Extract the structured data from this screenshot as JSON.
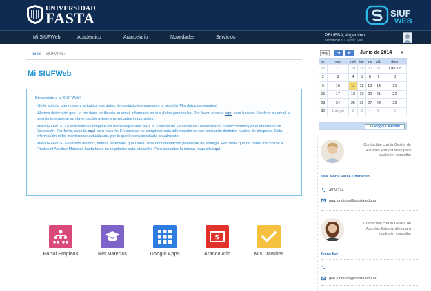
{
  "header": {
    "brand_top": "UNIVERSIDAD",
    "brand_main": "FASTA",
    "app_name_top": "SIUF",
    "app_name_bottom": "WEB"
  },
  "nav": {
    "items": [
      "Mi SIUFWeb",
      "Académico",
      "Arancelario",
      "Novedades",
      "Servicios"
    ],
    "user_name": "PRUEBA, Argentino",
    "user_role": "Modificar » Cerrar Ses."
  },
  "breadcrumb": {
    "home": "Inicio",
    "current": "SIUFWeb"
  },
  "page": {
    "title": "Mi SIUFWeb"
  },
  "messages": {
    "welcome": "Bienvenido a tu SIUFWeb!",
    "p1": "Se le solicita que revise y actualice sus datos de contacto ingresando a la sección 'Mis datos personales'.",
    "p2_a": "Hemos detectado que Ud. no tiene verificado su email informado en sus datos personales. Por favor, acceda",
    "p2_link": "aquí",
    "p2_b": "para hacerlo. Verificar su email le permitirá recuperar su clave, recibir avisos y novedades importantes.",
    "p3_a": "IMPORTANTE: Le solicitamos complete los datos requeridos para el Sistema de Estadísticas Universitarias confeccionado por el Ministerio de Educación. Por favor, acceda",
    "p3_link": "aquí",
    "p3_b": "para hacerlo. En caso de no completar esta información se van aplicando distintos niveles de bloqueos. Esta información debe mantenerse actualizada, por lo que le será solicitada anualmente.",
    "p4_a": "IMPORTANTE: Estimado alumno, hemos detectado que usted tiene documentación pendiente de entrega. Recuerde que no podrá inscribirse a Finales ni Aprobar Materias hasta tanto no regularice esta situación. Para consultar la misma haga clic",
    "p4_link": "aquí"
  },
  "apps": [
    {
      "label": "Portal Empleos",
      "color": "#d9497a",
      "icon": "people-network-icon"
    },
    {
      "label": "Mis Materias",
      "color": "#7e64c9",
      "icon": "graduation-cap-icon"
    },
    {
      "label": "Google Apps",
      "color": "#2f7de1",
      "icon": "grid-apps-icon"
    },
    {
      "label": "Arancelario",
      "color": "#e1332b",
      "icon": "money-icon"
    },
    {
      "label": "Mis Trámites",
      "color": "#f5c13f",
      "icon": "check-icon"
    }
  ],
  "calendar": {
    "today_label": "Hoy",
    "month": "Junio de 2014",
    "weekdays": [
      "lun",
      "mar",
      "mié",
      "jue",
      "vie",
      "sáb",
      "dom"
    ],
    "weeks": [
      [
        "26",
        "27",
        "28",
        "29",
        "30",
        "31",
        "1 de jun"
      ],
      [
        "2",
        "3",
        "4",
        "5",
        "6",
        "7",
        "8"
      ],
      [
        "9",
        "10",
        "11",
        "12",
        "13",
        "14",
        "15"
      ],
      [
        "16",
        "17",
        "18",
        "19",
        "20",
        "21",
        "22"
      ],
      [
        "23",
        "24",
        "25",
        "26",
        "27",
        "28",
        "29"
      ],
      [
        "30",
        "1 de jul",
        "2",
        "3",
        "4",
        "5",
        "6"
      ]
    ],
    "today": "11",
    "add_button": "Google Calendar"
  },
  "contacts": [
    {
      "intro": "Contactáte con tu Gestor de Asuntos Estudiantiles para cualquier consulta:",
      "name": "Dra. María Paula Chimento",
      "phone": "4924274",
      "email": "gaa.juridicas@ufasta.edu.ar"
    },
    {
      "intro": "Contactáte con tu Gestor de Asuntos Estudiantiles para cualquier consulta:",
      "name": "Ivana Iter",
      "phone": "",
      "email": "gae.juridicas@ufasta.edu.ar"
    }
  ]
}
